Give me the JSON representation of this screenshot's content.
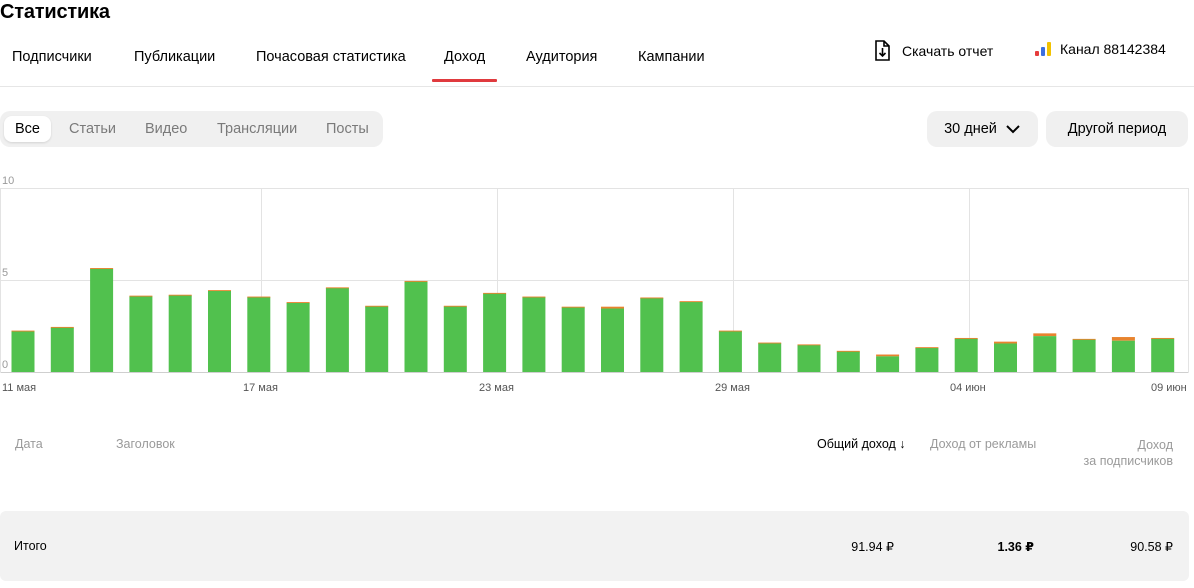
{
  "page": {
    "title": "Статистика"
  },
  "tabs": [
    {
      "label": "Подписчики"
    },
    {
      "label": "Публикации"
    },
    {
      "label": "Почасовая статистика"
    },
    {
      "label": "Доход",
      "active": true
    },
    {
      "label": "Аудитория"
    },
    {
      "label": "Кампании"
    }
  ],
  "header": {
    "download_label": "Скачать отчет",
    "channel_label": "Канал 88142384",
    "download_icon": "download-file-icon",
    "channel_icon": "bar-logo-icon",
    "accent_color": "#e03a3e"
  },
  "content_filter": [
    {
      "label": "Все",
      "active": true
    },
    {
      "label": "Статьи"
    },
    {
      "label": "Видео"
    },
    {
      "label": "Трансляции"
    },
    {
      "label": "Посты"
    }
  ],
  "period": {
    "selected_label": "30 дней",
    "other_label": "Другой период",
    "chevron_icon": "chevron-down-icon"
  },
  "chart_data": {
    "type": "bar",
    "stacked": true,
    "ylim": [
      0,
      10
    ],
    "yticks": [
      "10",
      "5",
      "0"
    ],
    "xticks": [
      "11 мая",
      "17 мая",
      "23 мая",
      "29 мая",
      "04 июн",
      "09 июн"
    ],
    "grid": true,
    "colors": {
      "subscribers": "#51c14e",
      "ads": "#e8832e"
    },
    "days": 31,
    "series": [
      {
        "values": [
          2.2,
          2.4,
          5.6,
          4.1,
          4.15,
          4.4,
          4.05,
          3.75,
          4.55,
          3.55,
          4.9,
          3.55,
          4.25,
          4.05,
          3.5,
          3.45,
          4.0,
          3.8,
          2.2,
          1.55,
          1.45,
          1.1,
          0.85,
          1.3,
          1.8,
          1.55,
          1.95,
          1.75,
          1.7,
          1.8,
          0
        ]
      },
      {
        "values": [
          0.05,
          0.05,
          0.05,
          0.05,
          0.05,
          0.05,
          0.05,
          0.05,
          0.05,
          0.05,
          0.05,
          0.05,
          0.05,
          0.05,
          0.05,
          0.1,
          0.05,
          0.05,
          0.05,
          0.05,
          0.05,
          0.05,
          0.1,
          0.05,
          0.05,
          0.1,
          0.15,
          0.05,
          0.2,
          0.05,
          0
        ]
      }
    ]
  },
  "table": {
    "headers": {
      "date": "Дата",
      "title": "Заголовок",
      "total": "Общий доход ↓",
      "ads": "Доход от рекламы",
      "subs_line1": "Доход",
      "subs_line2": "за подписчиков"
    },
    "total_row": {
      "label": "Итого",
      "total": "91.94 ₽",
      "ads": "1.36 ₽",
      "subs": "90.58 ₽"
    }
  }
}
